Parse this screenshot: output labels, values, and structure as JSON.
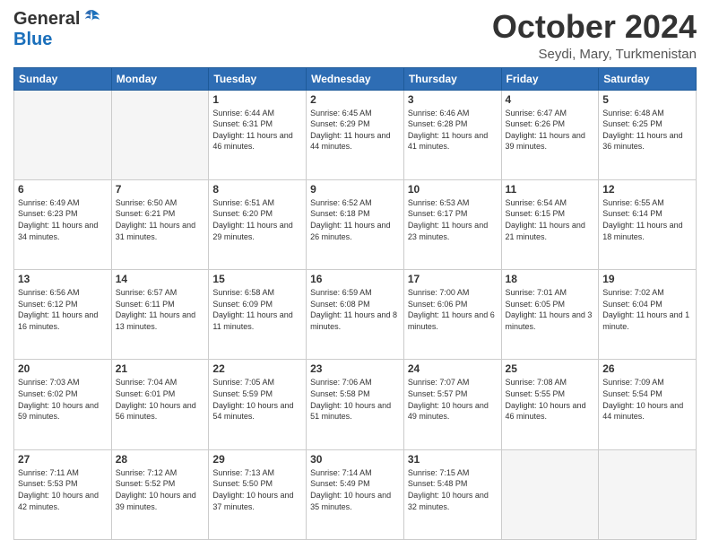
{
  "header": {
    "logo_general": "General",
    "logo_blue": "Blue",
    "month_title": "October 2024",
    "location": "Seydi, Mary, Turkmenistan"
  },
  "days_of_week": [
    "Sunday",
    "Monday",
    "Tuesday",
    "Wednesday",
    "Thursday",
    "Friday",
    "Saturday"
  ],
  "weeks": [
    [
      {
        "day": "",
        "info": ""
      },
      {
        "day": "",
        "info": ""
      },
      {
        "day": "1",
        "info": "Sunrise: 6:44 AM\nSunset: 6:31 PM\nDaylight: 11 hours and 46 minutes."
      },
      {
        "day": "2",
        "info": "Sunrise: 6:45 AM\nSunset: 6:29 PM\nDaylight: 11 hours and 44 minutes."
      },
      {
        "day": "3",
        "info": "Sunrise: 6:46 AM\nSunset: 6:28 PM\nDaylight: 11 hours and 41 minutes."
      },
      {
        "day": "4",
        "info": "Sunrise: 6:47 AM\nSunset: 6:26 PM\nDaylight: 11 hours and 39 minutes."
      },
      {
        "day": "5",
        "info": "Sunrise: 6:48 AM\nSunset: 6:25 PM\nDaylight: 11 hours and 36 minutes."
      }
    ],
    [
      {
        "day": "6",
        "info": "Sunrise: 6:49 AM\nSunset: 6:23 PM\nDaylight: 11 hours and 34 minutes."
      },
      {
        "day": "7",
        "info": "Sunrise: 6:50 AM\nSunset: 6:21 PM\nDaylight: 11 hours and 31 minutes."
      },
      {
        "day": "8",
        "info": "Sunrise: 6:51 AM\nSunset: 6:20 PM\nDaylight: 11 hours and 29 minutes."
      },
      {
        "day": "9",
        "info": "Sunrise: 6:52 AM\nSunset: 6:18 PM\nDaylight: 11 hours and 26 minutes."
      },
      {
        "day": "10",
        "info": "Sunrise: 6:53 AM\nSunset: 6:17 PM\nDaylight: 11 hours and 23 minutes."
      },
      {
        "day": "11",
        "info": "Sunrise: 6:54 AM\nSunset: 6:15 PM\nDaylight: 11 hours and 21 minutes."
      },
      {
        "day": "12",
        "info": "Sunrise: 6:55 AM\nSunset: 6:14 PM\nDaylight: 11 hours and 18 minutes."
      }
    ],
    [
      {
        "day": "13",
        "info": "Sunrise: 6:56 AM\nSunset: 6:12 PM\nDaylight: 11 hours and 16 minutes."
      },
      {
        "day": "14",
        "info": "Sunrise: 6:57 AM\nSunset: 6:11 PM\nDaylight: 11 hours and 13 minutes."
      },
      {
        "day": "15",
        "info": "Sunrise: 6:58 AM\nSunset: 6:09 PM\nDaylight: 11 hours and 11 minutes."
      },
      {
        "day": "16",
        "info": "Sunrise: 6:59 AM\nSunset: 6:08 PM\nDaylight: 11 hours and 8 minutes."
      },
      {
        "day": "17",
        "info": "Sunrise: 7:00 AM\nSunset: 6:06 PM\nDaylight: 11 hours and 6 minutes."
      },
      {
        "day": "18",
        "info": "Sunrise: 7:01 AM\nSunset: 6:05 PM\nDaylight: 11 hours and 3 minutes."
      },
      {
        "day": "19",
        "info": "Sunrise: 7:02 AM\nSunset: 6:04 PM\nDaylight: 11 hours and 1 minute."
      }
    ],
    [
      {
        "day": "20",
        "info": "Sunrise: 7:03 AM\nSunset: 6:02 PM\nDaylight: 10 hours and 59 minutes."
      },
      {
        "day": "21",
        "info": "Sunrise: 7:04 AM\nSunset: 6:01 PM\nDaylight: 10 hours and 56 minutes."
      },
      {
        "day": "22",
        "info": "Sunrise: 7:05 AM\nSunset: 5:59 PM\nDaylight: 10 hours and 54 minutes."
      },
      {
        "day": "23",
        "info": "Sunrise: 7:06 AM\nSunset: 5:58 PM\nDaylight: 10 hours and 51 minutes."
      },
      {
        "day": "24",
        "info": "Sunrise: 7:07 AM\nSunset: 5:57 PM\nDaylight: 10 hours and 49 minutes."
      },
      {
        "day": "25",
        "info": "Sunrise: 7:08 AM\nSunset: 5:55 PM\nDaylight: 10 hours and 46 minutes."
      },
      {
        "day": "26",
        "info": "Sunrise: 7:09 AM\nSunset: 5:54 PM\nDaylight: 10 hours and 44 minutes."
      }
    ],
    [
      {
        "day": "27",
        "info": "Sunrise: 7:11 AM\nSunset: 5:53 PM\nDaylight: 10 hours and 42 minutes."
      },
      {
        "day": "28",
        "info": "Sunrise: 7:12 AM\nSunset: 5:52 PM\nDaylight: 10 hours and 39 minutes."
      },
      {
        "day": "29",
        "info": "Sunrise: 7:13 AM\nSunset: 5:50 PM\nDaylight: 10 hours and 37 minutes."
      },
      {
        "day": "30",
        "info": "Sunrise: 7:14 AM\nSunset: 5:49 PM\nDaylight: 10 hours and 35 minutes."
      },
      {
        "day": "31",
        "info": "Sunrise: 7:15 AM\nSunset: 5:48 PM\nDaylight: 10 hours and 32 minutes."
      },
      {
        "day": "",
        "info": ""
      },
      {
        "day": "",
        "info": ""
      }
    ]
  ]
}
